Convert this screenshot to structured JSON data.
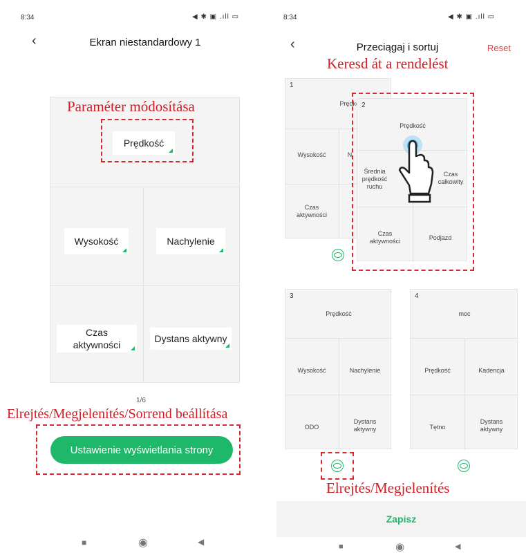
{
  "left": {
    "status": {
      "time": "8:34",
      "icons": "◀ ✱ ▣ .ıll ▭"
    },
    "title": "Ekran niestandardowy 1",
    "cells": {
      "top": "Prędkość",
      "mid_left": "Wysokość",
      "mid_right": "Nachylenie",
      "bot_left": "Czas\naktywności",
      "bot_right": "Dystans aktywny"
    },
    "page_indicator": "1/6",
    "button_label": "Ustawienie wyświetlania strony",
    "annotations": {
      "top": "Paraméter módosítása",
      "bottom": "Elrejtés/Megjelenítés/Sorrend beállítása"
    }
  },
  "right": {
    "status": {
      "time": "8:34",
      "icons": "◀ ✱ ▣ .ıll ▭"
    },
    "title": "Przeciągaj i sortuj",
    "reset_label": "Reset",
    "annotations": {
      "top": "Keresd át a rendelést",
      "bottom": "Elrejtés/Megjelenítés"
    },
    "card1": {
      "num": "1",
      "c1": "Prędkoś",
      "c2": "Wysokość",
      "c3": "N",
      "c4": "Czas\naktywności"
    },
    "card2": {
      "num": "2",
      "c1": "Prędkość",
      "c2": "Średnia\nprędkość\nruchu",
      "c3": "Czas\ncałkowity",
      "c4": "Czas\naktywności",
      "c5": "Podjazd"
    },
    "card3": {
      "num": "3",
      "c1": "Prędkość",
      "c2": "Wysokość",
      "c3": "Nachylenie",
      "c4": "ODO",
      "c5": "Dystans\naktywny"
    },
    "card4": {
      "num": "4",
      "c1": "moc",
      "c2": "Prędkość",
      "c3": "Kadencja",
      "c4": "Tętno",
      "c5": "Dystans\naktywny"
    },
    "save_label": "Zapisz"
  },
  "colors": {
    "accent": "#1fb86a",
    "annotation": "#d01e26"
  }
}
